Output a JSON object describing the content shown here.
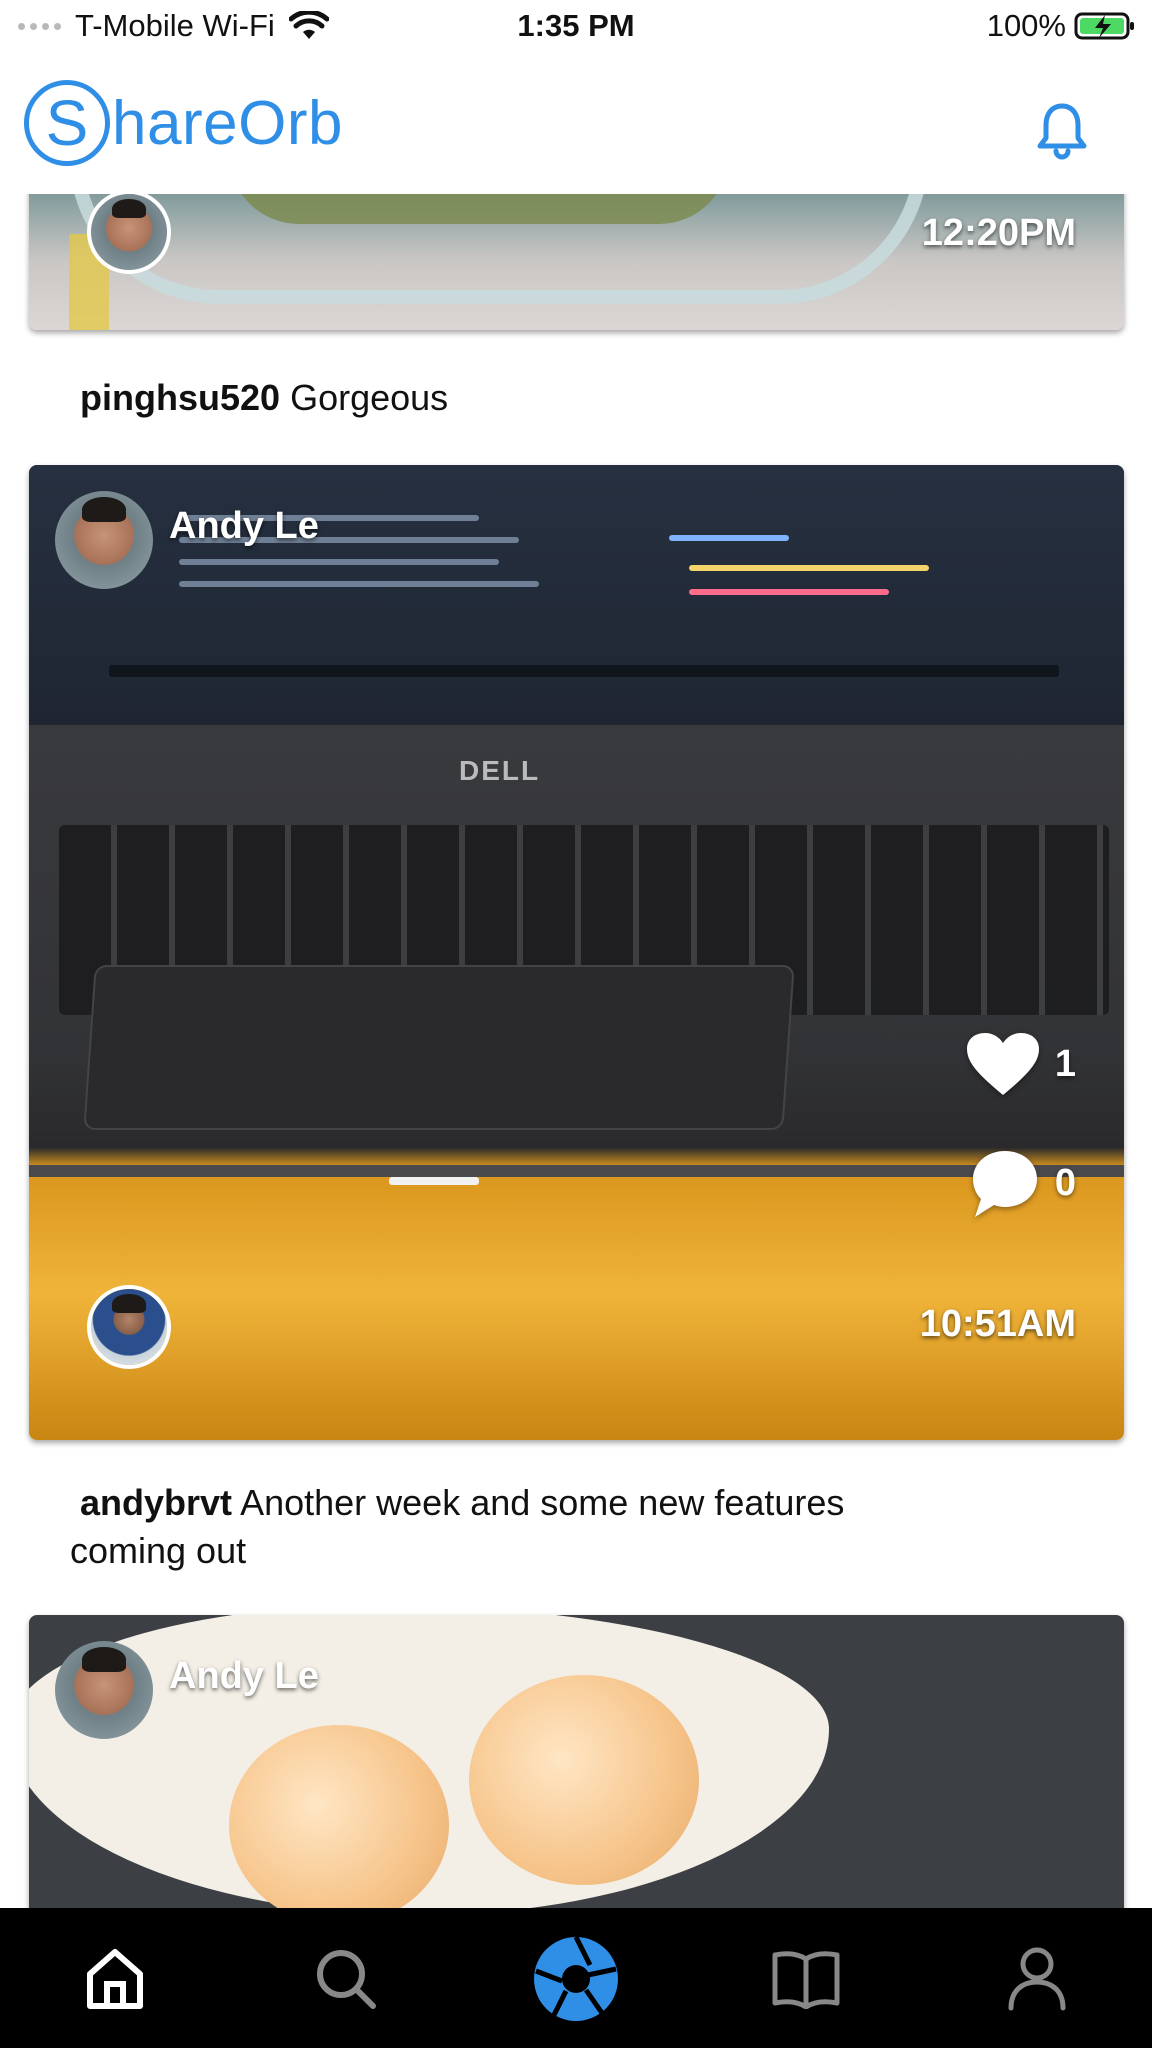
{
  "status_bar": {
    "carrier": "T-Mobile Wi-Fi",
    "time": "1:35 PM",
    "battery": "100%"
  },
  "header": {
    "logo_letter": "S",
    "logo_text": "hareOrb",
    "accent_color": "#2f8ee6",
    "bell_icon": "bell-icon"
  },
  "feed": {
    "posts": [
      {
        "time": "12:20PM",
        "caption_user": "pinghsu520",
        "caption_text": "Gorgeous"
      },
      {
        "author": "Andy Le",
        "time": "10:51AM",
        "likes": "1",
        "comments": "0",
        "caption_user": "andybrvt",
        "caption_text": "Another week and some new features",
        "caption_text_2": "coming out"
      },
      {
        "author": "Andy Le"
      }
    ]
  },
  "tab_bar": {
    "tabs": [
      "home-icon",
      "search-icon",
      "camera-icon",
      "book-icon",
      "profile-icon"
    ],
    "active_color": "#2f8ee6"
  }
}
